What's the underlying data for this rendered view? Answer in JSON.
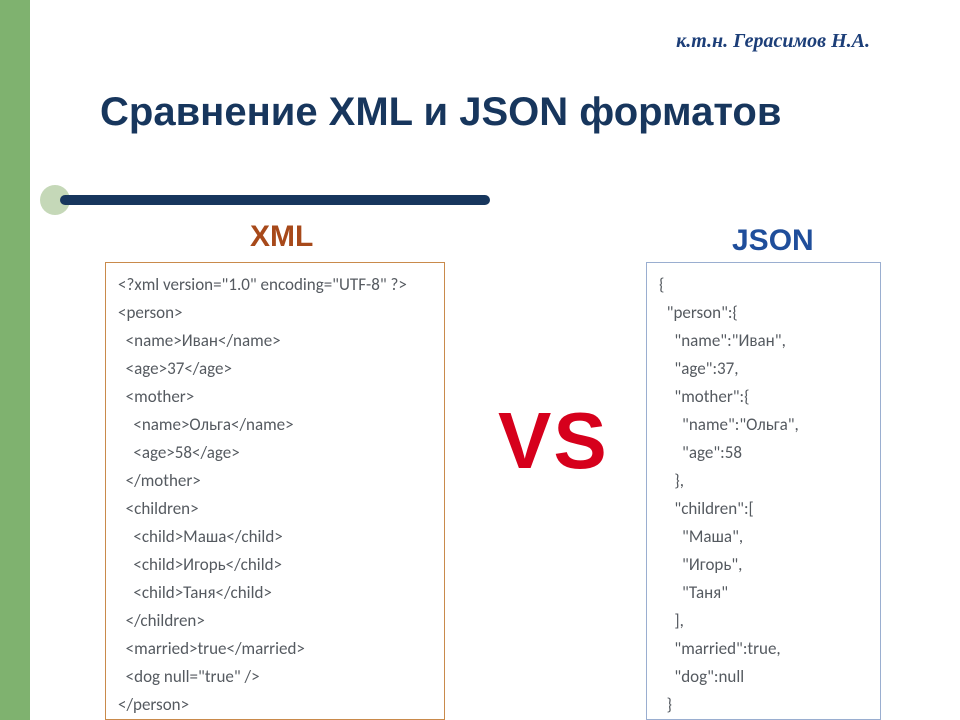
{
  "credit": "к.т.н. Герасимов Н.А.",
  "title": "Сравнение XML и JSON форматов",
  "labels": {
    "xml": "XML",
    "json": "JSON",
    "vs": "VS"
  },
  "xml_lines": [
    "<?xml version=\"1.0\" encoding=\"UTF-8\" ?>",
    "<person>",
    "  <name>Иван</name>",
    "  <age>37</age>",
    "  <mother>",
    "    <name>Ольга</name>",
    "    <age>58</age>",
    "  </mother>",
    "  <children>",
    "    <child>Маша</child>",
    "    <child>Игорь</child>",
    "    <child>Таня</child>",
    "  </children>",
    "  <married>true</married>",
    "  <dog null=\"true\" />",
    "</person>"
  ],
  "json_lines": [
    "{",
    "  \"person\":{",
    "    \"name\":\"Иван\",",
    "    \"age\":37,",
    "    \"mother\":{",
    "      \"name\":\"Ольга\",",
    "      \"age\":58",
    "    },",
    "    \"children\":[",
    "      \"Маша\",",
    "      \"Игорь\",",
    "      \"Таня\"",
    "    ],",
    "    \"married\":true,",
    "    \"dog\":null",
    "  }"
  ]
}
